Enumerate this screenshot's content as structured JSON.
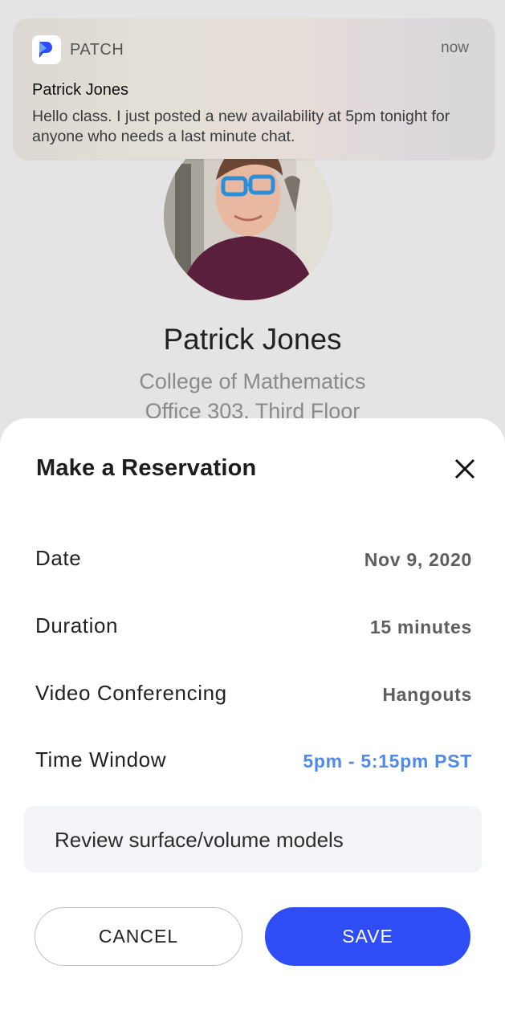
{
  "notification": {
    "app_name": "PATCH",
    "time": "now",
    "title": "Patrick Jones",
    "body": "Hello class. I just posted a new availability at 5pm tonight for anyone who needs a last minute chat."
  },
  "profile": {
    "name": "Patrick Jones",
    "department": "College of Mathematics",
    "office": "Office 303, Third Floor"
  },
  "sheet": {
    "title": "Make a Reservation",
    "close_icon": "close-icon",
    "rows": [
      {
        "label": "Date",
        "value": "Nov 9, 2020"
      },
      {
        "label": "Duration",
        "value": "15 minutes"
      },
      {
        "label": "Video Conferencing",
        "value": "Hangouts"
      },
      {
        "label": "Time Window",
        "value": "5pm - 5:15pm PST"
      }
    ],
    "note": "Review surface/volume models",
    "cancel_label": "CANCEL",
    "save_label": "SAVE"
  },
  "colors": {
    "accent": "#2f4df7",
    "link": "#4f8ae8",
    "backdrop": "#e4e4e4"
  }
}
